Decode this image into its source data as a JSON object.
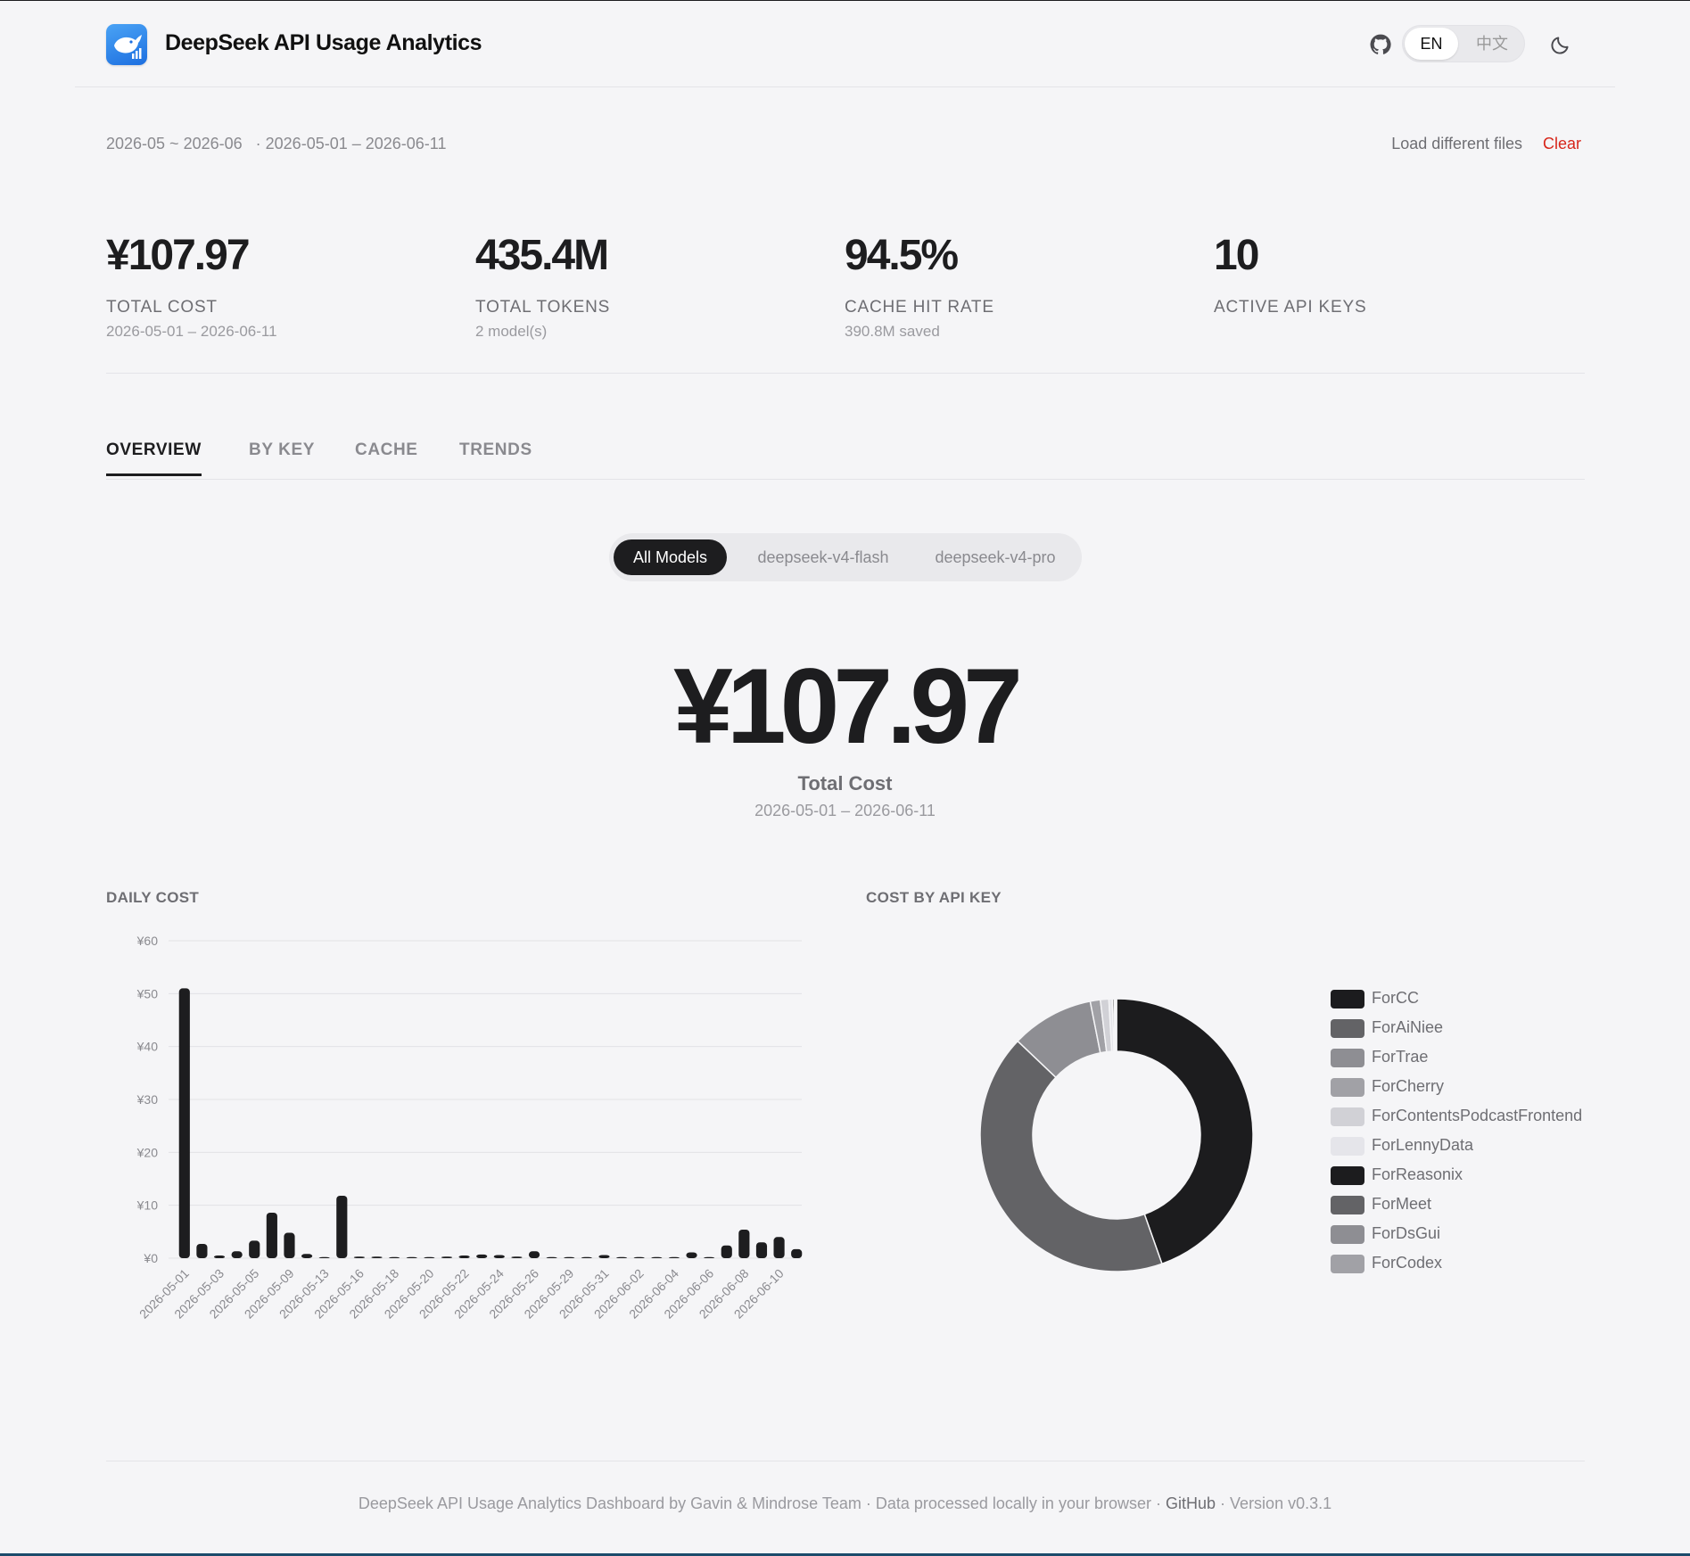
{
  "header": {
    "title": "DeepSeek API Usage Analytics",
    "lang_en": "EN",
    "lang_zh": "中文"
  },
  "range": {
    "months": "2026-05 ~ 2026-06",
    "dates": "· 2026-05-01 – 2026-06-11",
    "load_files": "Load different files",
    "clear": "Clear"
  },
  "stats": [
    {
      "value": "¥107.97",
      "label": "TOTAL COST",
      "sub": "2026-05-01 – 2026-06-11"
    },
    {
      "value": "435.4M",
      "label": "TOTAL TOKENS",
      "sub": "2 model(s)"
    },
    {
      "value": "94.5%",
      "label": "CACHE HIT RATE",
      "sub": "390.8M saved"
    },
    {
      "value": "10",
      "label": "ACTIVE API KEYS",
      "sub": ""
    }
  ],
  "tabs": [
    {
      "label": "OVERVIEW",
      "active": true
    },
    {
      "label": "BY KEY",
      "active": false
    },
    {
      "label": "CACHE",
      "active": false
    },
    {
      "label": "TRENDS",
      "active": false
    }
  ],
  "models": [
    {
      "label": "All Models",
      "active": true
    },
    {
      "label": "deepseek-v4-flash",
      "active": false
    },
    {
      "label": "deepseek-v4-pro",
      "active": false
    }
  ],
  "big_total": {
    "value": "¥107.97",
    "label": "Total Cost",
    "sub": "2026-05-01 – 2026-06-11"
  },
  "sections": {
    "daily": "DAILY COST",
    "by_key": "COST BY API KEY"
  },
  "chart_data": [
    {
      "type": "bar",
      "title": "DAILY COST",
      "xlabel": "",
      "ylabel": "",
      "ylim": [
        0,
        60
      ],
      "yticks": [
        "¥0",
        "¥10",
        "¥20",
        "¥30",
        "¥40",
        "¥50",
        "¥60"
      ],
      "grid": true,
      "x_tick_labels": [
        "2026-05-01",
        "2026-05-03",
        "2026-05-05",
        "2026-05-09",
        "2026-05-13",
        "2026-05-16",
        "2026-05-18",
        "2026-05-20",
        "2026-05-22",
        "2026-05-24",
        "2026-05-26",
        "2026-05-29",
        "2026-05-31",
        "2026-06-02",
        "2026-06-04",
        "2026-06-06",
        "2026-06-08",
        "2026-06-10"
      ],
      "values": [
        51,
        2.7,
        0.5,
        1.3,
        3.3,
        8.6,
        4.8,
        0.8,
        0.1,
        11.8,
        0.3,
        0.3,
        0.2,
        0.2,
        0.2,
        0.3,
        0.5,
        0.7,
        0.6,
        0.3,
        1.3,
        0.2,
        0.2,
        0.2,
        0.6,
        0.1,
        0.1,
        0.1,
        0.2,
        1.1,
        0.1,
        2.4,
        5.4,
        3.0,
        4.0,
        1.7
      ],
      "color": "#1d1d1f"
    },
    {
      "type": "pie",
      "title": "COST BY API KEY",
      "legend": "right",
      "categories": [
        "ForCC",
        "ForAiNiee",
        "ForTrae",
        "ForCherry",
        "ForContentsPodcastFrontend",
        "ForLennyData",
        "ForReasonix",
        "ForMeet",
        "ForDsGui",
        "ForCodex"
      ],
      "values": [
        44.6,
        42.5,
        9.8,
        1.2,
        1.0,
        0.4,
        0.2,
        0.1,
        0.1,
        0.1
      ],
      "colors": [
        "#1c1c1e",
        "#636366",
        "#8e8e93",
        "#a1a1a6",
        "#d1d1d6",
        "#e5e5ea",
        "#1c1c1e",
        "#636366",
        "#8e8e93",
        "#a1a1a6"
      ]
    }
  ],
  "footer": {
    "text": "DeepSeek API Usage Analytics Dashboard by Gavin & Mindrose Team · Data processed locally in your browser ·",
    "github": "GitHub",
    "version": "· Version v0.3.1"
  }
}
